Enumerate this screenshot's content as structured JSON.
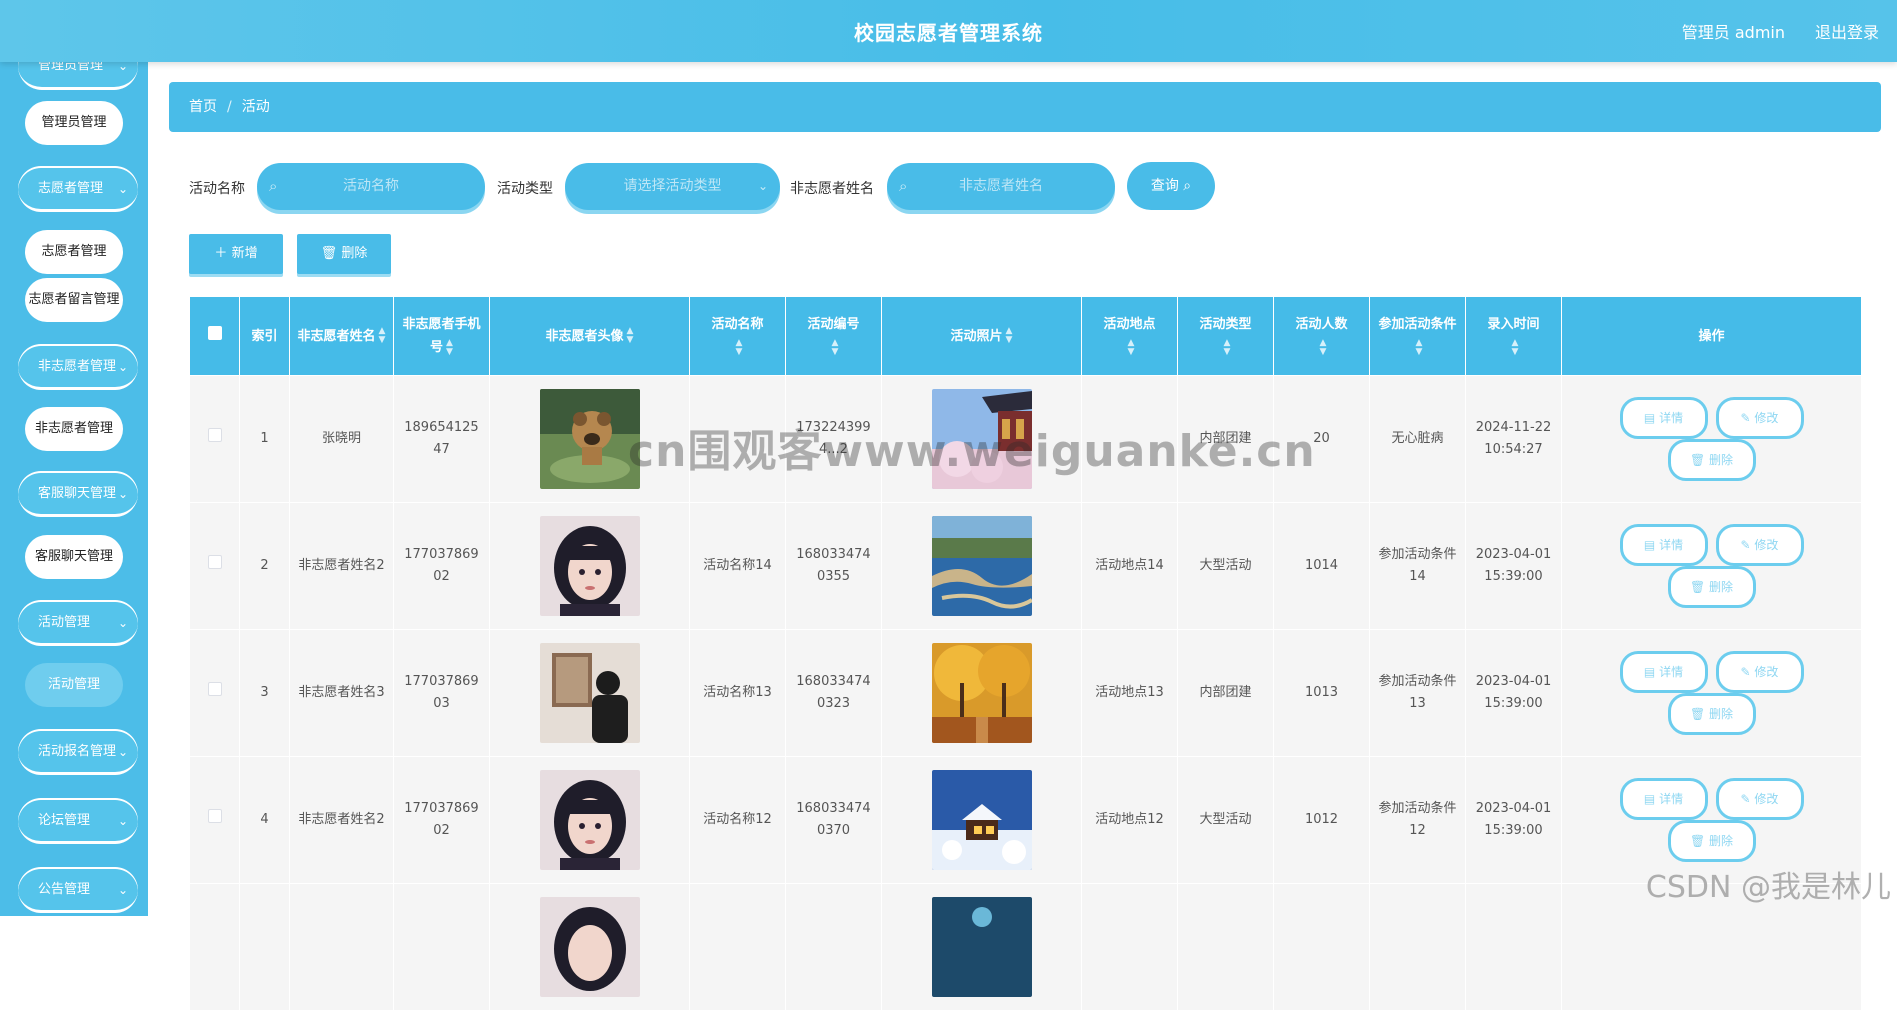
{
  "header": {
    "title": "校园志愿者管理系统",
    "user_label": "管理员 admin",
    "logout_label": "退出登录"
  },
  "sidebar": {
    "groups": [
      {
        "label": "管理员管理",
        "sub": [
          {
            "label": "管理员管理",
            "active": false
          }
        ]
      },
      {
        "label": "志愿者管理",
        "sub": [
          {
            "label": "志愿者管理",
            "active": false
          },
          {
            "label": "志愿者留言管理",
            "active": false
          }
        ]
      },
      {
        "label": "非志愿者管理",
        "sub": [
          {
            "label": "非志愿者管理",
            "active": false
          }
        ]
      },
      {
        "label": "客服聊天管理",
        "sub": [
          {
            "label": "客服聊天管理",
            "active": false
          }
        ]
      },
      {
        "label": "活动管理",
        "sub": [
          {
            "label": "活动管理",
            "active": true
          }
        ]
      },
      {
        "label": "活动报名管理",
        "sub": []
      },
      {
        "label": "论坛管理",
        "sub": []
      },
      {
        "label": "公告管理",
        "sub": []
      }
    ]
  },
  "breadcrumb": {
    "home": "首页",
    "separator": "/",
    "current": "活动"
  },
  "search": {
    "name_label": "活动名称",
    "name_placeholder": "活动名称",
    "type_label": "活动类型",
    "type_placeholder": "请选择活动类型",
    "person_label": "非志愿者姓名",
    "person_placeholder": "非志愿者姓名",
    "query_label": "查询"
  },
  "actions": {
    "add_label": "新增",
    "delete_label": "删除"
  },
  "table": {
    "headers": {
      "index": "索引",
      "name": "非志愿者姓名",
      "phone": "非志愿者手机号",
      "avatar": "非志愿者头像",
      "activity_name": "活动名称",
      "activity_no": "活动编号",
      "photo": "活动照片",
      "location": "活动地点",
      "type": "活动类型",
      "count": "活动人数",
      "condition": "参加活动条件",
      "time": "录入时间",
      "ops": "操作"
    },
    "op_labels": {
      "detail": "详情",
      "edit": "修改",
      "delete": "删除"
    },
    "rows": [
      {
        "index": "1",
        "name": "张晓明",
        "phone": "18965412547",
        "activity_name": "",
        "activity_no": "1732243994...2",
        "location": "",
        "type": "内部团建",
        "count": "20",
        "condition": "无心脏病",
        "time": "2024-11-22 10:54:27"
      },
      {
        "index": "2",
        "name": "非志愿者姓名2",
        "phone": "17703786902",
        "activity_name": "活动名称14",
        "activity_no": "1680334740355",
        "location": "活动地点14",
        "type": "大型活动",
        "count": "1014",
        "condition": "参加活动条件14",
        "time": "2023-04-01 15:39:00"
      },
      {
        "index": "3",
        "name": "非志愿者姓名3",
        "phone": "17703786903",
        "activity_name": "活动名称13",
        "activity_no": "1680334740323",
        "location": "活动地点13",
        "type": "内部团建",
        "count": "1013",
        "condition": "参加活动条件13",
        "time": "2023-04-01 15:39:00"
      },
      {
        "index": "4",
        "name": "非志愿者姓名2",
        "phone": "17703786902",
        "activity_name": "活动名称12",
        "activity_no": "1680334740370",
        "location": "活动地点12",
        "type": "大型活动",
        "count": "1012",
        "condition": "参加活动条件12",
        "time": "2023-04-01 15:39:00"
      }
    ]
  },
  "watermarks": {
    "center": "cn围观客www.weiguanke.cn",
    "corner": "CSDN @我是林儿"
  }
}
